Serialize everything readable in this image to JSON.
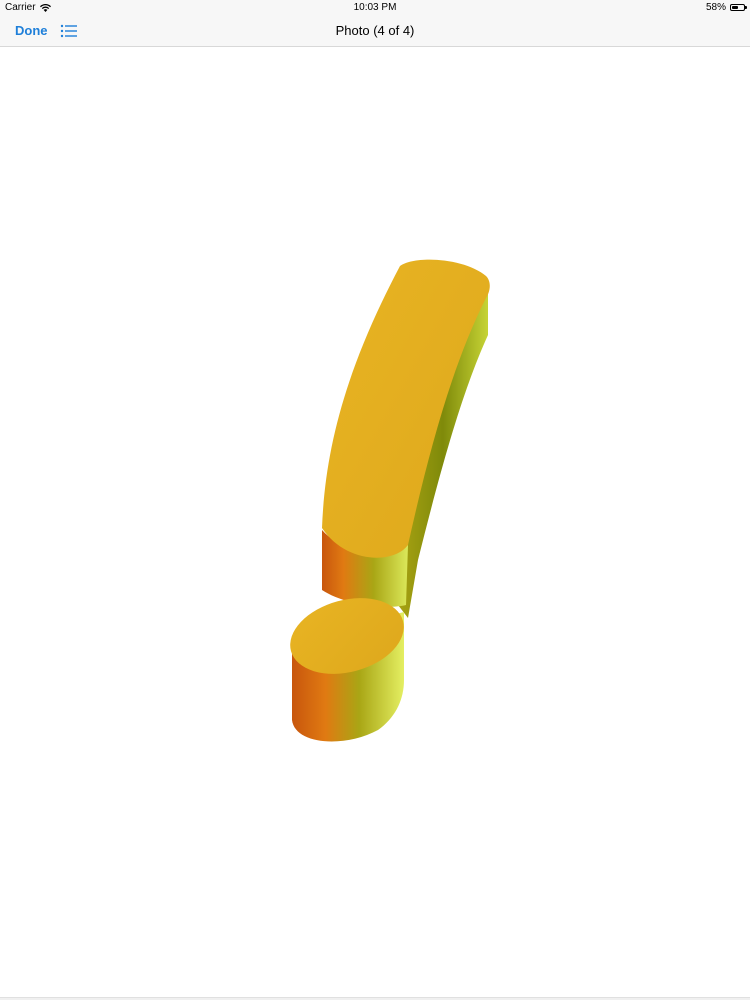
{
  "status_bar": {
    "carrier": "Carrier",
    "wifi_icon": "wifi-icon",
    "time": "10:03 PM",
    "battery_percent": "58%",
    "battery_level": 0.58,
    "battery_icon": "battery-icon"
  },
  "nav_bar": {
    "done_label": "Done",
    "list_icon": "list-icon",
    "title": "Photo (4 of 4)"
  },
  "photo": {
    "subject_icon": "exclamation-mark-3d-icon",
    "colors": {
      "top_face": "#e3ad1e",
      "side_dark": "#c8560d",
      "side_light": "#d9e84a",
      "accent_blue": "#1e7fd9"
    }
  }
}
